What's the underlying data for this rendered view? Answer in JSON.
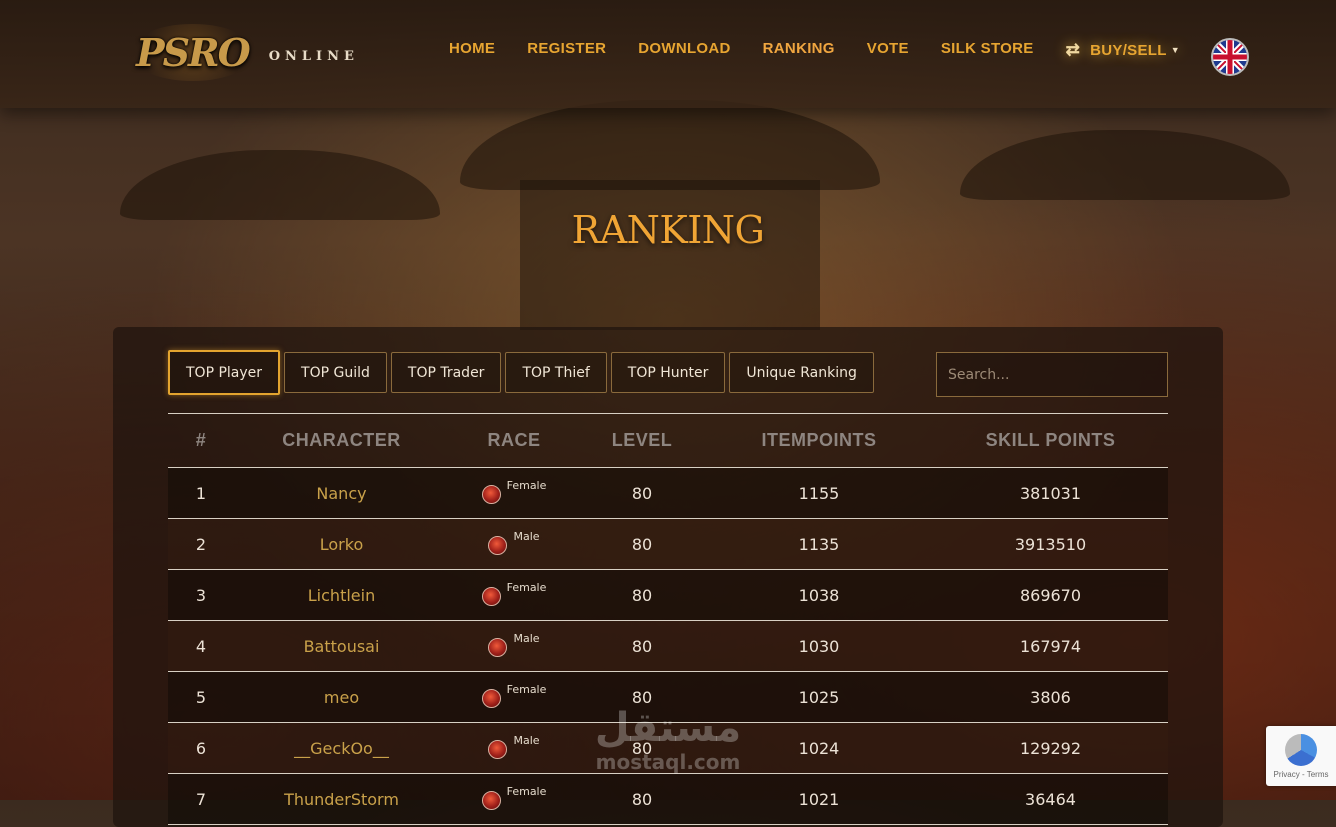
{
  "header": {
    "logo_mark": "PSRO",
    "logo_sub": "ONLINE",
    "nav": [
      {
        "label": "HOME"
      },
      {
        "label": "REGISTER"
      },
      {
        "label": "DOWNLOAD"
      },
      {
        "label": "RANKING"
      },
      {
        "label": "VOTE"
      },
      {
        "label": "SILK STORE"
      },
      {
        "label": "BUY/SELL"
      }
    ],
    "active_nav": "RANKING",
    "language": "English (UK flag)"
  },
  "page_title": "RANKING",
  "tabs": [
    {
      "label": "TOP Player"
    },
    {
      "label": "TOP Guild"
    },
    {
      "label": "TOP Trader"
    },
    {
      "label": "TOP Thief"
    },
    {
      "label": "TOP Hunter"
    },
    {
      "label": "Unique Ranking"
    }
  ],
  "active_tab": "TOP Player",
  "search": {
    "placeholder": "Search...",
    "value": ""
  },
  "table": {
    "headers": {
      "rank": "#",
      "character": "CHARACTER",
      "race": "RACE",
      "level": "LEVEL",
      "itempoints": "ITEMPOINTS",
      "skillpoints": "SKILL POINTS"
    },
    "rows": [
      {
        "rank": "1",
        "character": "Nancy",
        "gender": "Female",
        "level": "80",
        "itempoints": "1155",
        "skillpoints": "381031"
      },
      {
        "rank": "2",
        "character": "Lorko",
        "gender": "Male",
        "level": "80",
        "itempoints": "1135",
        "skillpoints": "3913510"
      },
      {
        "rank": "3",
        "character": "Lichtlein",
        "gender": "Female",
        "level": "80",
        "itempoints": "1038",
        "skillpoints": "869670"
      },
      {
        "rank": "4",
        "character": "Battousai",
        "gender": "Male",
        "level": "80",
        "itempoints": "1030",
        "skillpoints": "167974"
      },
      {
        "rank": "5",
        "character": "meo",
        "gender": "Female",
        "level": "80",
        "itempoints": "1025",
        "skillpoints": "3806"
      },
      {
        "rank": "6",
        "character": "__GeckOo__",
        "gender": "Male",
        "level": "80",
        "itempoints": "1024",
        "skillpoints": "129292"
      },
      {
        "rank": "7",
        "character": "ThunderStorm",
        "gender": "Female",
        "level": "80",
        "itempoints": "1021",
        "skillpoints": "36464"
      }
    ]
  },
  "watermark": {
    "arabic": "مستقل",
    "latin": "mostaql.com"
  },
  "recaptcha": {
    "text": "Privacy - Terms"
  },
  "colors": {
    "accent": "#e7a531",
    "title": "#f0a535",
    "character_link": "#c9a14a",
    "header_text": "#8e8580"
  }
}
